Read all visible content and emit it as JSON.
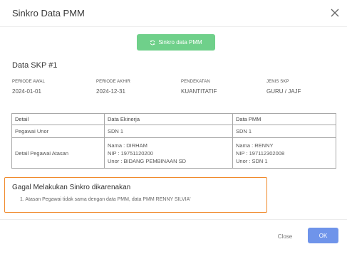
{
  "modal": {
    "title": "Sinkro Data PMM",
    "sync_button_label": "Sinkro data PMM"
  },
  "skp": {
    "heading": "Data SKP #1",
    "fields": [
      {
        "label": "PERIODE AWAL",
        "value": "2024-01-01"
      },
      {
        "label": "PERIODE AKHIR",
        "value": "2024-12-31"
      },
      {
        "label": "PENDEKATAN",
        "value": "KUANTITATIF"
      },
      {
        "label": "JENIS SKP",
        "value": "GURU / JAJF"
      }
    ]
  },
  "comparison": {
    "headers": [
      "Detail",
      "Data Ekinerja",
      "Data PMM"
    ],
    "rows": [
      {
        "detail": "Pegawai Unor",
        "ekinerja": [
          "SDN 1"
        ],
        "pmm": [
          "SDN 1"
        ]
      },
      {
        "detail": "Detail Pegawai Atasan",
        "ekinerja": [
          "Nama : DIRHAM",
          "NIP : 19751120200",
          "Unor : BIDANG PEMBINAAN SD"
        ],
        "pmm": [
          "Nama : RENNY",
          "NIP : 197112302008",
          "Unor : SDN 1"
        ]
      }
    ]
  },
  "error": {
    "title": "Gagal Melakukan Sinkro dikarenakan",
    "items": [
      "1. Atasan Pegawai tidak sama dengan data PMM, data PMM RENNY SILVIA'"
    ],
    "border_color": "#f08a2c"
  },
  "footer": {
    "close_label": "Close",
    "ok_label": "OK"
  },
  "colors": {
    "sync_button": "#6fd08a",
    "ok_button": "#6f94ea"
  }
}
